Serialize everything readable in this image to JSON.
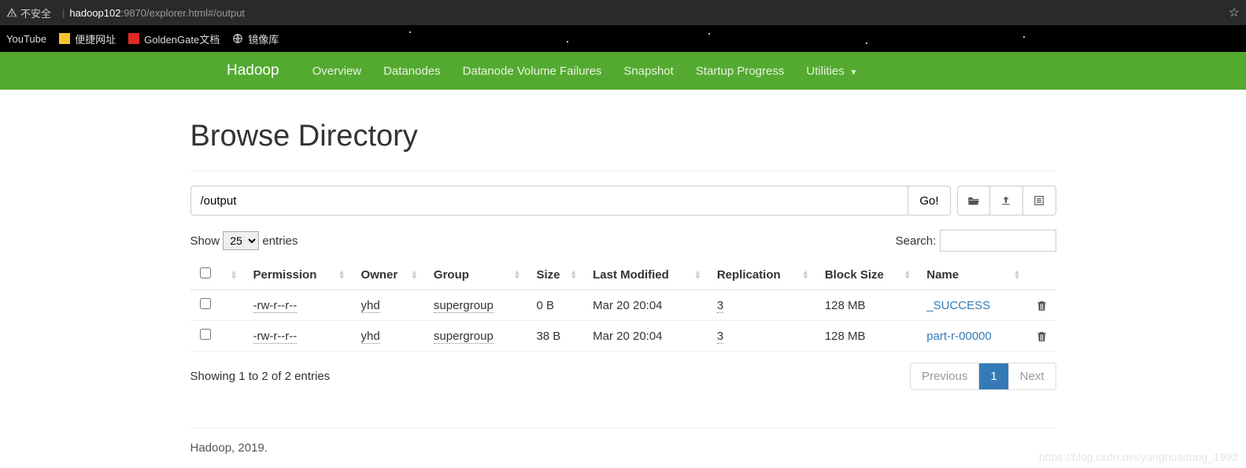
{
  "browser": {
    "warning_label": "不安全",
    "url_host": "hadoop102",
    "url_port": ":9870",
    "url_path": "/explorer.html#/output"
  },
  "bookmarks": {
    "items": [
      {
        "label": "YouTube",
        "icon": "none"
      },
      {
        "label": "便捷网址",
        "icon": "yellow"
      },
      {
        "label": "GoldenGate文档",
        "icon": "red"
      },
      {
        "label": "镜像库",
        "icon": "globe"
      }
    ]
  },
  "nav": {
    "brand": "Hadoop",
    "items": [
      "Overview",
      "Datanodes",
      "Datanode Volume Failures",
      "Snapshot",
      "Startup Progress",
      "Utilities"
    ]
  },
  "page": {
    "title": "Browse Directory",
    "path_value": "/output",
    "go_label": "Go!"
  },
  "table_controls": {
    "show_label": "Show",
    "entries_label": "entries",
    "entries_value": "25",
    "search_label": "Search:"
  },
  "table": {
    "headers": [
      "",
      "",
      "Permission",
      "Owner",
      "Group",
      "Size",
      "Last Modified",
      "Replication",
      "Block Size",
      "Name",
      ""
    ],
    "rows": [
      {
        "permission": "-rw-r--r--",
        "owner": "yhd",
        "group": "supergroup",
        "size": "0 B",
        "modified": "Mar 20 20:04",
        "replication": "3",
        "blocksize": "128 MB",
        "name": "_SUCCESS"
      },
      {
        "permission": "-rw-r--r--",
        "owner": "yhd",
        "group": "supergroup",
        "size": "38 B",
        "modified": "Mar 20 20:04",
        "replication": "3",
        "blocksize": "128 MB",
        "name": "part-r-00000"
      }
    ]
  },
  "table_footer": {
    "info": "Showing 1 to 2 of 2 entries",
    "prev": "Previous",
    "next": "Next",
    "page": "1"
  },
  "footer": {
    "text": "Hadoop, 2019."
  },
  "watermark": "https://blog.csdn.net/yanghuadong_1992"
}
